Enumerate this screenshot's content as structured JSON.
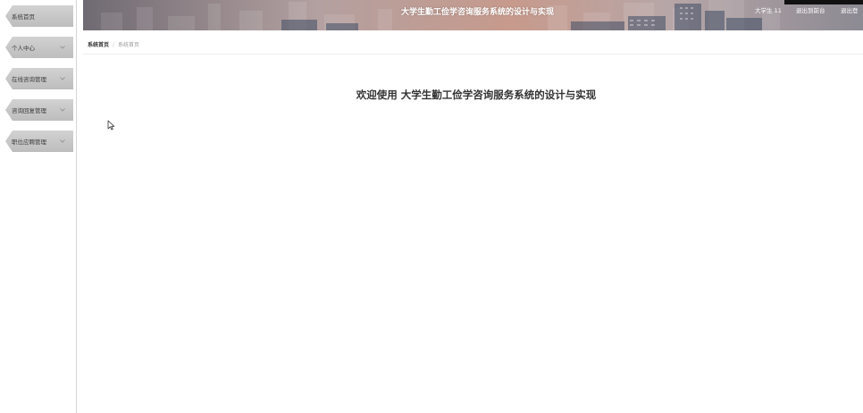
{
  "header": {
    "title": "大学生勤工俭学咨询服务系统的设计与实现",
    "user": "大学生 11",
    "back_button": "退出到前台",
    "logout_button": "退出登"
  },
  "sidebar": {
    "items": [
      {
        "label": "系统首页",
        "has_chevron": false
      },
      {
        "label": "个人中心",
        "has_chevron": true
      },
      {
        "label": "在线咨询管理",
        "has_chevron": true
      },
      {
        "label": "咨询回复管理",
        "has_chevron": true
      },
      {
        "label": "职位应聘管理",
        "has_chevron": true
      }
    ]
  },
  "breadcrumb": {
    "home": "系统首页",
    "separator": "/",
    "current": "系统首页"
  },
  "main": {
    "welcome": "欢迎使用 大学生勤工俭学咨询服务系统的设计与实现"
  },
  "icons": {
    "chevron": "chevron-down-icon",
    "cursor": "mouse-pointer-icon"
  }
}
